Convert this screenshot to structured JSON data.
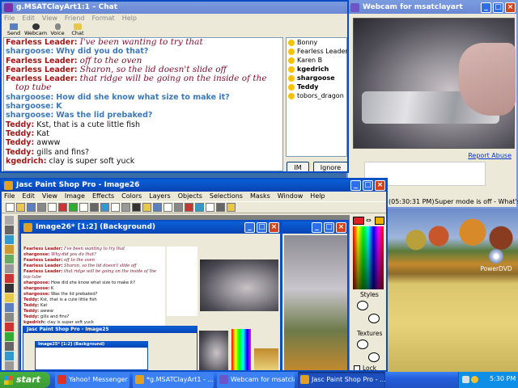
{
  "chat_window": {
    "title": "g.MSATClayArt1:1 – Chat",
    "menu": [
      "File",
      "Edit",
      "View",
      "Friend",
      "Format",
      "Help"
    ],
    "toolbar": [
      {
        "label": "Send File",
        "icon": "send-file-icon"
      },
      {
        "label": "Webcam",
        "icon": "webcam-icon"
      },
      {
        "label": "Voice",
        "icon": "voice-icon"
      },
      {
        "label": "Chat",
        "icon": "chat-icon"
      }
    ],
    "messages": [
      {
        "name": "Fearless Leader:",
        "text": "I've been wanting to try that",
        "style": "it"
      },
      {
        "name": "shargoose:",
        "text": "Why did you do that?",
        "style": "bl"
      },
      {
        "name": "Fearless Leader:",
        "text": "off to the oven",
        "style": "it"
      },
      {
        "name": "Fearless Leader:",
        "text": "Sharon, so the lid doesn't slide off",
        "style": "it"
      },
      {
        "name": "Fearless Leader:",
        "text": "that ridge will be going on the inside of the",
        "style": "it"
      },
      {
        "name": "",
        "text": "top tube",
        "style": "it"
      },
      {
        "name": "shargoose:",
        "text": "How did she know what size to make it?",
        "style": "bl"
      },
      {
        "name": "shargoose:",
        "text": "K",
        "style": "bl"
      },
      {
        "name": "shargoose:",
        "text": "Was the lid prebaked?",
        "style": "bl"
      },
      {
        "name": "Teddy:",
        "text": "Kst, that is a cute little fish",
        "style": "bk"
      },
      {
        "name": "Teddy:",
        "text": "Kat",
        "style": "bk"
      },
      {
        "name": "Teddy:",
        "text": "awww",
        "style": "bk"
      },
      {
        "name": "Teddy:",
        "text": "gills and fins?",
        "style": "bk"
      },
      {
        "name": "kgedrich:",
        "text": "clay is super soft yuck",
        "style": "bk"
      }
    ],
    "users": [
      "Bonny",
      "Fearless Leader",
      "Karen B",
      "kgedrich",
      "shargoose",
      "Teddy",
      "tobors_dragon"
    ],
    "im_label": "IM",
    "ignore_label": "Ignore User"
  },
  "webcam_window": {
    "title": "Webcam for msatclayart",
    "report_abuse": "Report Abuse",
    "time": "(05:30:31 PM)",
    "super_mode": "Super mode is off - What's ?"
  },
  "psp_window": {
    "title": "Jasc Paint Shop Pro - Image26",
    "menu": [
      "File",
      "Edit",
      "View",
      "Image",
      "Effects",
      "Colors",
      "Layers",
      "Objects",
      "Selections",
      "Masks",
      "Window",
      "Help"
    ],
    "image_title": "Image26* [1:2] (Background)",
    "styles_label": "Styles",
    "textures_label": "Textures",
    "lock_label": "Lock"
  },
  "nested_chat": {
    "lines": [
      {
        "name": "Fearless Leader:",
        "text": "I've been wanting to try that"
      },
      {
        "name": "shargoose:",
        "text": "Why did you do that?"
      },
      {
        "name": "Fearless Leader:",
        "text": "off to the oven"
      },
      {
        "name": "Fearless Leader:",
        "text": "Sharon, so the lid doesn't slide off"
      },
      {
        "name": "Fearless Leader:",
        "text": "that ridge will be going on the inside of the"
      },
      {
        "name": "",
        "text": "top tube"
      },
      {
        "name": "shargoose:",
        "text": "How did she know what size to make it?"
      },
      {
        "name": "shargoose:",
        "text": "K"
      },
      {
        "name": "shargoose:",
        "text": "Was the lid prebaked?"
      },
      {
        "name": "Teddy:",
        "text": "Kst, that is a cute little fish"
      },
      {
        "name": "Teddy:",
        "text": "Kat"
      },
      {
        "name": "Teddy:",
        "text": "awww"
      },
      {
        "name": "Teddy:",
        "text": "gills and fins?"
      },
      {
        "name": "kgedrich:",
        "text": "clay is super soft yuck"
      }
    ],
    "psp_title": "Jasc Paint Shop Pro - Image25",
    "image_title": "Image25* [1:2] (Background)"
  },
  "desktop": {
    "icon_label": "PowerDVD"
  },
  "taskbar": {
    "start": "start",
    "tasks": [
      "Yahoo! Messenger (I...",
      "*g.MSATClayArt1 - ...",
      "Webcam for msatclay...",
      "Jasc Paint Shop Pro - ..."
    ],
    "clock": "5:30 PM"
  },
  "colors": {
    "title_active": "#0a4cc4",
    "taskbar": "#245edb",
    "start": "#3c9a34"
  }
}
